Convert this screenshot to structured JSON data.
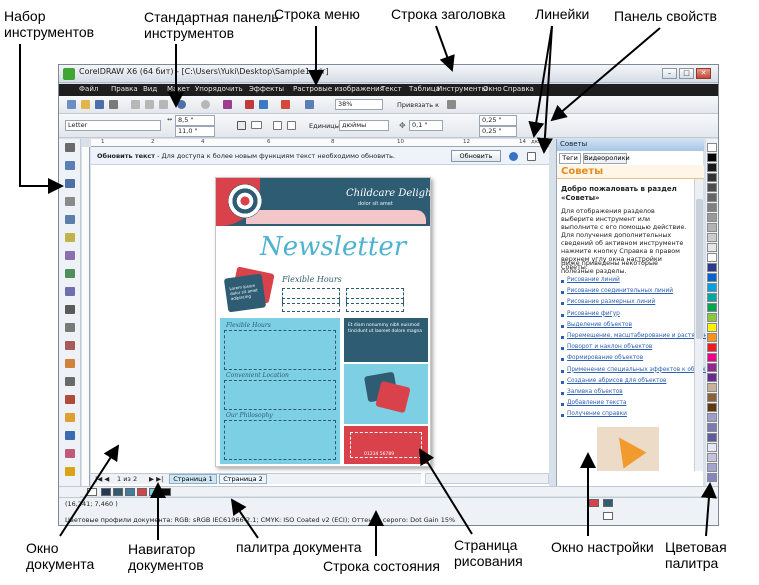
{
  "callouts": {
    "toolbox": "Набор\nинструментов",
    "standard_toolbar": "Стандартная панель\nинструментов",
    "menu_bar": "Строка меню",
    "title_bar": "Строка заголовка",
    "rulers": "Линейки",
    "property_bar": "Панель свойств",
    "document_window": "Окно\nдокумента",
    "document_navigator": "Навигатор\nдокументов",
    "document_palette": "палитра документа",
    "drawing_page": "Страница\nрисования",
    "status_bar": "Строка состояния",
    "docker": "Окно настройки",
    "color_palette": "Цветовая\nпалитра"
  },
  "window": {
    "title": "CorelDRAW X6 (64 бит) - [C:\\Users\\Yuki\\Desktop\\Sample1.cdr]"
  },
  "menu": [
    "Файл",
    "Правка",
    "Вид",
    "Макет",
    "Упорядочить",
    "Эффекты",
    "Растровые изображения",
    "Текст",
    "Таблица",
    "Инструменты",
    "Окно",
    "Справка"
  ],
  "standard_toolbar": {
    "zoom": "38%",
    "snap": "Привязать к"
  },
  "property_bar": {
    "paper_size": "Letter",
    "width": "8,5 \"",
    "height": "11,0 \"",
    "units_label": "Единицы:",
    "units": "дюймы",
    "nudge": "0,1 \"",
    "dup_x": "0,25 \"",
    "dup_y": "0,25 \""
  },
  "ruler": {
    "ticks": [
      "1",
      "2",
      "4",
      "6",
      "8",
      "10",
      "12",
      "14"
    ],
    "unit": "дюймы"
  },
  "notice": {
    "title": "Обновить текст",
    "text": "- Для доступа к более новым функциям текст необходимо обновить.",
    "button": "Обновить"
  },
  "page": {
    "brand": "Childcare Delight",
    "brand_sub": "dolor sit amet",
    "title": "Newsletter",
    "flex_hours": "Flexible Hours",
    "card_text": "Lorem ipsum dolor sit amet adipiscing",
    "section1": "Flexible Hours",
    "section2": "Convenient Location",
    "section3": "Our Philosophy",
    "right_text": "Et diam nonummy nibh euismod tincidunt ut laoreet dolore magna",
    "phone": "01234 56789"
  },
  "docker": {
    "title": "Советы",
    "tabs": [
      "Теги",
      "Видеоролики"
    ],
    "heading": "Советы",
    "welcome": "Добро пожаловать в раздел «Советы»",
    "intro": "Для отображения разделов выберите инструмент или выполните с его помощью действие. Для получения дополнительных сведений об активном инструменте нажмите кнопку Справка в правом верхнем углу окна настройки Советы.",
    "useful": "Ниже приведены некоторые полезные разделы.",
    "links": [
      "Рисование линий",
      "Рисование соединительных линий",
      "Рисование размерных линий",
      "Рисование фигур",
      "Выделение объектов",
      "Перемещение, масштабирование и растяжение объектов",
      "Поворот и наклон объектов",
      "Формирование объектов",
      "Применение специальных эффектов к объектам",
      "Создание абрисов для объектов",
      "Заливка объектов",
      "Добавление текста",
      "Получение справки"
    ]
  },
  "navigator": {
    "page_count": "1 из 2",
    "tabs": [
      "Страница 1",
      "Страница 2"
    ]
  },
  "status": {
    "coords": "(16,241; 7,460 )",
    "color_profiles": "Цветовые профили документа: RGB: sRGB IEC61966-2.1; CMYK: ISO Coated v2 (ECI); Оттенки серого: Dot Gain 15%"
  },
  "colors": {
    "teal": "#2e5d73",
    "light_blue": "#7dcfe4",
    "red": "#d9414b",
    "accent_orange": "#e58a1f",
    "palette": [
      "#ffffff",
      "#000000",
      "#1a1a1a",
      "#333333",
      "#4d4d4d",
      "#666666",
      "#808080",
      "#999999",
      "#b3b3b3",
      "#cccccc",
      "#e6e6e6",
      "#ffffff",
      "#2b3a8f",
      "#0066cc",
      "#00a3e0",
      "#00a99d",
      "#00a651",
      "#8dc63f",
      "#fff200",
      "#f7941d",
      "#ed1c24",
      "#ec008c",
      "#92278f",
      "#662d91",
      "#c7b299",
      "#8c6239",
      "#603913",
      "#9e9ec8",
      "#7b7bb4",
      "#5c5c9e",
      "#e6e6f5",
      "#c3c3e0",
      "#a3a3d0",
      "#8585c0"
    ],
    "document_palette": [
      "#1f3a5a",
      "#2e5d73",
      "#3c7fa0",
      "#d9414b",
      "#7dcfe4",
      "#0c0c0c"
    ]
  }
}
